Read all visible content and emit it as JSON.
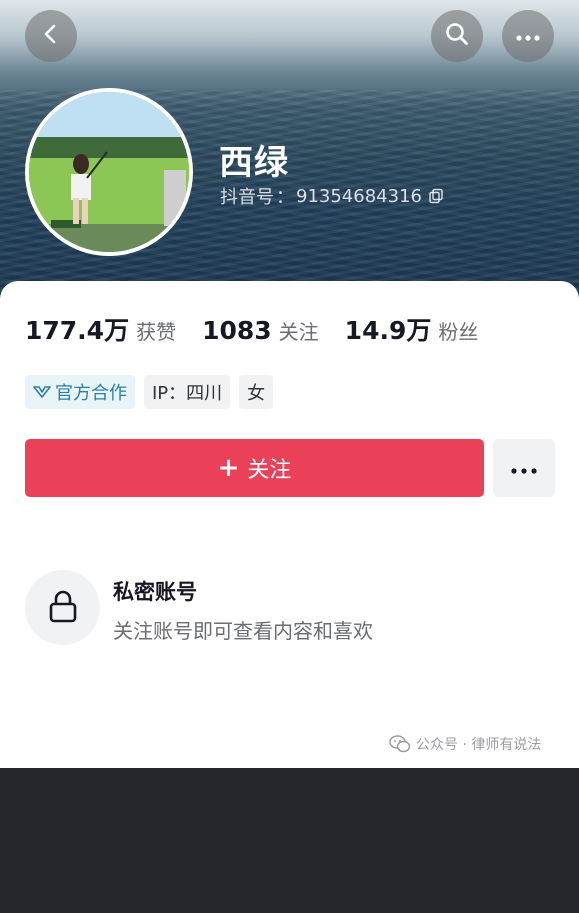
{
  "profile": {
    "name": "西绿",
    "id_label": "抖音号",
    "id_separator": "：",
    "id_value": "91354684316"
  },
  "stats": [
    {
      "value": "177.4万",
      "label": "获赞"
    },
    {
      "value": "1083",
      "label": "关注"
    },
    {
      "value": "14.9万",
      "label": "粉丝"
    }
  ],
  "tags": {
    "official": "官方合作",
    "ip": "IP：四川",
    "gender": "女"
  },
  "actions": {
    "follow_icon": "+",
    "follow_label": "关注"
  },
  "private": {
    "title": "私密账号",
    "description": "关注账号即可查看内容和喜欢"
  },
  "watermark": {
    "text": "公众号 · 律师有说法"
  },
  "icons": [
    "back-icon",
    "search-icon",
    "more-icon",
    "copy-icon",
    "official-cooperation-icon",
    "lock-icon",
    "wechat-icon"
  ],
  "colors": {
    "accent": "#ea4058",
    "official_tag": "#2a7fa7"
  }
}
